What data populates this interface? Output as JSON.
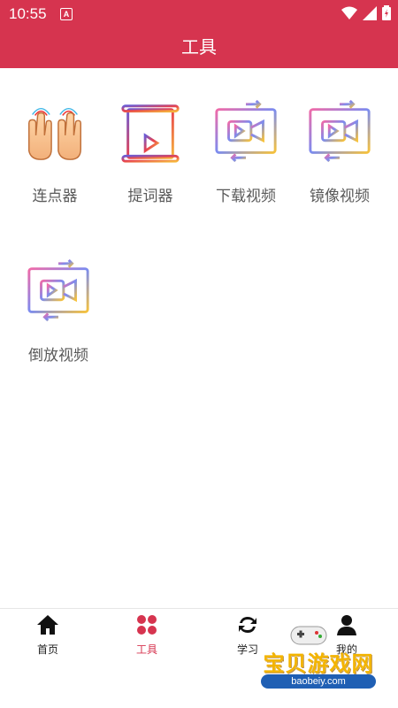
{
  "status_bar": {
    "time": "10:55",
    "notif_letter": "A"
  },
  "header": {
    "title": "工具"
  },
  "tools": [
    {
      "label": "连点器",
      "icon": "tap-hands-icon"
    },
    {
      "label": "提词器",
      "icon": "teleprompter-scroll-icon"
    },
    {
      "label": "下载视频",
      "icon": "video-download-icon"
    },
    {
      "label": "镜像视频",
      "icon": "video-mirror-icon"
    },
    {
      "label": "倒放视频",
      "icon": "video-reverse-icon"
    }
  ],
  "bottom_nav": [
    {
      "label": "首页",
      "icon": "home-icon"
    },
    {
      "label": "工具",
      "icon": "tools-grid-icon",
      "active": true
    },
    {
      "label": "学习",
      "icon": "refresh-icon"
    },
    {
      "label": "我的",
      "icon": "user-icon"
    }
  ],
  "watermark": {
    "text": "宝贝游戏网",
    "url": "baobeiy.com"
  },
  "colors": {
    "primary": "#d6344f",
    "label": "#5a5a5a"
  }
}
